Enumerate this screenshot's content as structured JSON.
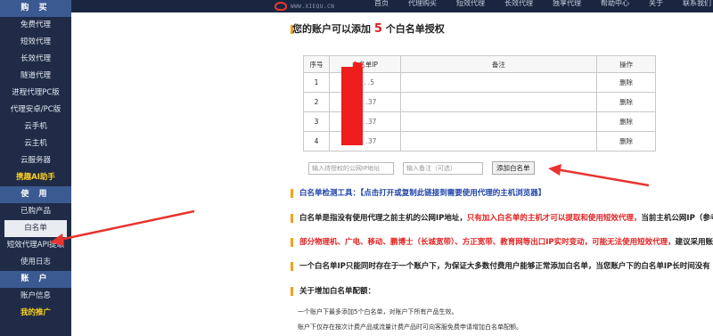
{
  "header": {
    "logo_text": "WWW.XIEQU.CN",
    "nav": [
      "首页",
      "代理购买",
      "短效代理",
      "长效代理",
      "独享代理",
      "帮助中心",
      "关于",
      "联系我们"
    ]
  },
  "sidebar": {
    "sections": [
      {
        "title": "购 买",
        "items": [
          "免费代理",
          "短效代理",
          "长效代理",
          "隧道代理",
          "进程代理PC版",
          "代理安卓/PC版",
          "云手机",
          "云主机",
          "云服务器",
          "携趣AI助手"
        ]
      },
      {
        "title": "使 用",
        "items": [
          "已购产品",
          "白名单",
          "短效代理API提取",
          "使用日志"
        ]
      },
      {
        "title": "账 户",
        "items": [
          "账户信息",
          "我的推广"
        ]
      }
    ],
    "active_item": "白名单",
    "highlight_item": "携趣AI助手"
  },
  "main": {
    "title_prefix": "您的账户可以添加",
    "title_count": "5",
    "title_suffix": "个白名单授权",
    "table": {
      "headers": [
        "序号",
        "白名单IP",
        "备注",
        "操作"
      ],
      "rows": [
        {
          "no": "1",
          "ip": "1.  .  .5",
          "note": "",
          "op": "删除"
        },
        {
          "no": "2",
          "ip": "1.  .  .37",
          "note": "",
          "op": "删除"
        },
        {
          "no": "3",
          "ip": "1.  .  .37",
          "note": "",
          "op": "删除"
        },
        {
          "no": "4",
          "ip": "1.  .  .37",
          "note": "",
          "op": "删除"
        }
      ]
    },
    "form": {
      "ip_placeholder": "输入待授权的公网IP地址",
      "note_placeholder": "输入备注（可选）",
      "add_button": "添加白名单"
    },
    "detect_label": "白名单检测工具：",
    "detect_link": "【点击打开或复制此链接到需要使用代理的主机浏览器】",
    "info1_a": "白名单是指没有使用代理之前主机的公网IP地址，",
    "info1_b": "只有加入白名单的主机才可以提取和使用短效代理，",
    "info1_c": "当前主机公网IP（参考）",
    "info2_a": "部分物理机、广电、移动、鹏博士（长城宽带）、方正宽带、教育网等出口IP实时变动，可能无法使用短效代理，",
    "info2_b": "建议采用账",
    "info3": "一个白名单IP只能同时存在于一个账户下，为保证大多数付费用户能够正常添加白名单，当您账户下的白名单IP长时间没有",
    "rules_title": "关于增加白名单配额：",
    "rule1": "一个账户下最多添加5个白名单，对账户下所有产品生效。",
    "rule2": "账户下仅存在按次计费产品或流量计费产品时可向客服免费申请增加白名单配额。"
  },
  "colors": {
    "sidebar_bg": "#1f2b47",
    "section_bg": "#3b5a92",
    "accent": "#f2a21b",
    "red": "#e02020",
    "blue": "#1c43a8"
  }
}
